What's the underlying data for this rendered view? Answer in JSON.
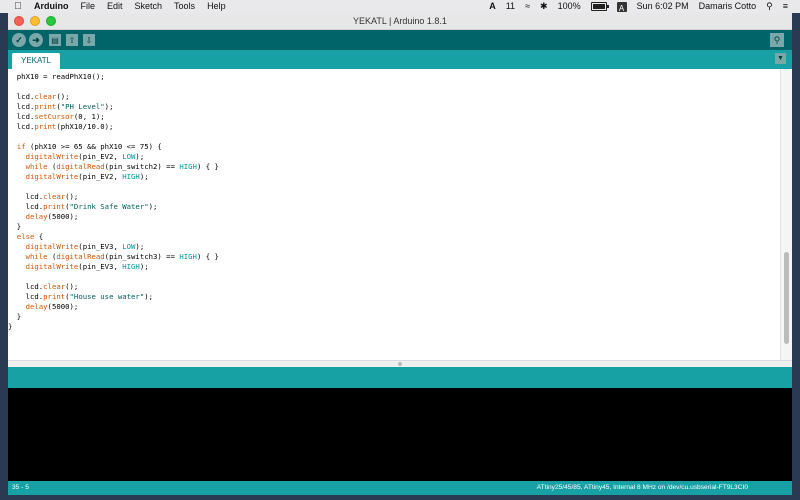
{
  "menubar": {
    "app_name": "Arduino",
    "items": [
      "File",
      "Edit",
      "Sketch",
      "Tools",
      "Help"
    ],
    "adobe_label": "A",
    "count_badge": "11",
    "battery_percent": "100%",
    "battery_level": 1.0,
    "input_badge": "A",
    "clock": "Sun 6:02 PM",
    "user": "Damaris Cotto"
  },
  "window": {
    "title": "YEKATL | Arduino 1.8.1"
  },
  "toolbar": {
    "verify_icon": "check-icon",
    "upload_icon": "arrow-right-icon",
    "new_icon": "file-icon",
    "open_icon": "arrow-up-icon",
    "save_icon": "arrow-down-icon",
    "serial_icon": "search-icon"
  },
  "tabs": [
    {
      "label": "YEKATL"
    }
  ],
  "editor": {
    "lines": [
      [
        {
          "t": "  phX10 = readPhX10();"
        }
      ],
      [
        {
          "t": ""
        }
      ],
      [
        {
          "t": "  lcd."
        },
        {
          "t": "clear",
          "c": "kw"
        },
        {
          "t": "();"
        }
      ],
      [
        {
          "t": "  lcd."
        },
        {
          "t": "print",
          "c": "kw"
        },
        {
          "t": "("
        },
        {
          "t": "\"PH Level\"",
          "c": "st"
        },
        {
          "t": ");"
        }
      ],
      [
        {
          "t": "  lcd."
        },
        {
          "t": "setCursor",
          "c": "kw"
        },
        {
          "t": "(0, 1);"
        }
      ],
      [
        {
          "t": "  lcd."
        },
        {
          "t": "print",
          "c": "kw"
        },
        {
          "t": "(phX10/10.0);"
        }
      ],
      [
        {
          "t": ""
        }
      ],
      [
        {
          "t": "  "
        },
        {
          "t": "if",
          "c": "kw"
        },
        {
          "t": " (phX10 >= 65 && phX10 <= 75) {"
        }
      ],
      [
        {
          "t": "    "
        },
        {
          "t": "digitalWrite",
          "c": "kw"
        },
        {
          "t": "(pin_EV2, "
        },
        {
          "t": "LOW",
          "c": "tb"
        },
        {
          "t": ");"
        }
      ],
      [
        {
          "t": "    "
        },
        {
          "t": "while",
          "c": "kw"
        },
        {
          "t": " ("
        },
        {
          "t": "digitalRead",
          "c": "kw"
        },
        {
          "t": "(pin_switch2) == "
        },
        {
          "t": "HIGH",
          "c": "tb"
        },
        {
          "t": ") { }"
        }
      ],
      [
        {
          "t": "    "
        },
        {
          "t": "digitalWrite",
          "c": "kw"
        },
        {
          "t": "(pin_EV2, "
        },
        {
          "t": "HIGH",
          "c": "tb"
        },
        {
          "t": ");"
        }
      ],
      [
        {
          "t": ""
        }
      ],
      [
        {
          "t": "    lcd."
        },
        {
          "t": "clear",
          "c": "kw"
        },
        {
          "t": "();"
        }
      ],
      [
        {
          "t": "    lcd."
        },
        {
          "t": "print",
          "c": "kw"
        },
        {
          "t": "("
        },
        {
          "t": "\"Drink Safe Water\"",
          "c": "st"
        },
        {
          "t": ");"
        }
      ],
      [
        {
          "t": "    "
        },
        {
          "t": "delay",
          "c": "kw"
        },
        {
          "t": "(5000);"
        }
      ],
      [
        {
          "t": "  }"
        }
      ],
      [
        {
          "t": "  "
        },
        {
          "t": "else",
          "c": "kw"
        },
        {
          "t": " {"
        }
      ],
      [
        {
          "t": "    "
        },
        {
          "t": "digitalWrite",
          "c": "kw"
        },
        {
          "t": "(pin_EV3, "
        },
        {
          "t": "LOW",
          "c": "tb"
        },
        {
          "t": ");"
        }
      ],
      [
        {
          "t": "    "
        },
        {
          "t": "while",
          "c": "kw"
        },
        {
          "t": " ("
        },
        {
          "t": "digitalRead",
          "c": "kw"
        },
        {
          "t": "(pin_switch3) == "
        },
        {
          "t": "HIGH",
          "c": "tb"
        },
        {
          "t": ") { }"
        }
      ],
      [
        {
          "t": "    "
        },
        {
          "t": "digitalWrite",
          "c": "kw"
        },
        {
          "t": "(pin_EV3, "
        },
        {
          "t": "HIGH",
          "c": "tb"
        },
        {
          "t": ");"
        }
      ],
      [
        {
          "t": ""
        }
      ],
      [
        {
          "t": "    lcd."
        },
        {
          "t": "clear",
          "c": "kw"
        },
        {
          "t": "();"
        }
      ],
      [
        {
          "t": "    lcd."
        },
        {
          "t": "print",
          "c": "kw"
        },
        {
          "t": "("
        },
        {
          "t": "\"House use water\"",
          "c": "st"
        },
        {
          "t": ");"
        }
      ],
      [
        {
          "t": "    "
        },
        {
          "t": "delay",
          "c": "kw"
        },
        {
          "t": "(5000);"
        }
      ],
      [
        {
          "t": "  }"
        }
      ],
      [
        {
          "t": "}"
        }
      ]
    ]
  },
  "statusbar": {
    "position": "35 - 5",
    "board_info": "ATtiny25/45/85, ATtiny45, Internal 8 MHz on /dev/cu.usbserial-FT9L3CI0"
  },
  "colors": {
    "toolbar": "#006468",
    "tabbar": "#17a1a5",
    "keyword": "#d35400",
    "constant": "#00979c",
    "string": "#005c5f",
    "console": "#000000"
  }
}
